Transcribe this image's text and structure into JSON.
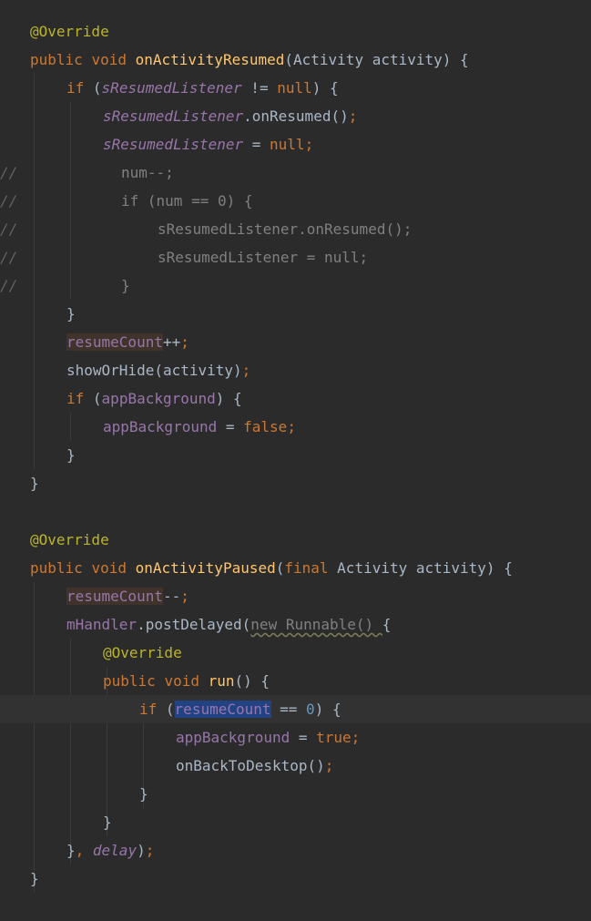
{
  "editor": {
    "lines": [
      {
        "indent": 33,
        "comment": "",
        "tokens": [
          {
            "t": "@Override",
            "c": "ann"
          }
        ]
      },
      {
        "indent": 33,
        "comment": "",
        "tokens": [
          {
            "t": "public ",
            "c": "kw"
          },
          {
            "t": "void ",
            "c": "kw"
          },
          {
            "t": "onActivityResumed",
            "c": "fn"
          },
          {
            "t": "(Activity activity) {",
            "c": "plain"
          }
        ]
      },
      {
        "indent": 73,
        "comment": "",
        "tokens": [
          {
            "t": "if ",
            "c": "kw"
          },
          {
            "t": "(",
            "c": "plain"
          },
          {
            "t": "sResumedListener",
            "c": "static"
          },
          {
            "t": " != ",
            "c": "plain"
          },
          {
            "t": "null",
            "c": "kw"
          },
          {
            "t": ") {",
            "c": "plain"
          }
        ]
      },
      {
        "indent": 113,
        "comment": "",
        "tokens": [
          {
            "t": "sResumedListener",
            "c": "static"
          },
          {
            "t": ".onResumed()",
            "c": "plain"
          },
          {
            "t": ";",
            "c": "punc"
          }
        ]
      },
      {
        "indent": 113,
        "comment": "",
        "tokens": [
          {
            "t": "sResumedListener",
            "c": "static"
          },
          {
            "t": " = ",
            "c": "plain"
          },
          {
            "t": "null",
            "c": "kw"
          },
          {
            "t": ";",
            "c": "punc"
          }
        ]
      },
      {
        "indent": 133,
        "comment": "//",
        "tokens": [
          {
            "t": "num--;",
            "c": "dim"
          }
        ]
      },
      {
        "indent": 133,
        "comment": "//",
        "tokens": [
          {
            "t": "if (num == 0) {",
            "c": "dim"
          }
        ]
      },
      {
        "indent": 173,
        "comment": "//",
        "tokens": [
          {
            "t": "sResumedListener.onResumed();",
            "c": "dim"
          }
        ]
      },
      {
        "indent": 173,
        "comment": "//",
        "tokens": [
          {
            "t": "sResumedListener = null;",
            "c": "dim"
          }
        ]
      },
      {
        "indent": 133,
        "comment": "//",
        "tokens": [
          {
            "t": "}",
            "c": "dim"
          }
        ]
      },
      {
        "indent": 73,
        "comment": "",
        "tokens": [
          {
            "t": "}",
            "c": "plain"
          }
        ]
      },
      {
        "indent": 73,
        "comment": "",
        "tokens": [
          {
            "t": "resumeCount",
            "c": "field",
            "hl": "write"
          },
          {
            "t": "++",
            "c": "plain"
          },
          {
            "t": ";",
            "c": "punc"
          }
        ]
      },
      {
        "indent": 73,
        "comment": "",
        "tokens": [
          {
            "t": "showOrHide(activity)",
            "c": "plain"
          },
          {
            "t": ";",
            "c": "punc"
          }
        ]
      },
      {
        "indent": 73,
        "comment": "",
        "tokens": [
          {
            "t": "if ",
            "c": "kw"
          },
          {
            "t": "(",
            "c": "plain"
          },
          {
            "t": "appBackground",
            "c": "field"
          },
          {
            "t": ") {",
            "c": "plain"
          }
        ]
      },
      {
        "indent": 113,
        "comment": "",
        "tokens": [
          {
            "t": "appBackground",
            "c": "field"
          },
          {
            "t": " = ",
            "c": "plain"
          },
          {
            "t": "false",
            "c": "kw"
          },
          {
            "t": ";",
            "c": "punc"
          }
        ]
      },
      {
        "indent": 73,
        "comment": "",
        "tokens": [
          {
            "t": "}",
            "c": "plain"
          }
        ]
      },
      {
        "indent": 33,
        "comment": "",
        "tokens": [
          {
            "t": "}",
            "c": "plain"
          }
        ]
      },
      {
        "indent": 33,
        "comment": "",
        "tokens": []
      },
      {
        "indent": 33,
        "comment": "",
        "tokens": [
          {
            "t": "@Override",
            "c": "ann"
          }
        ]
      },
      {
        "indent": 33,
        "comment": "",
        "tokens": [
          {
            "t": "public ",
            "c": "kw"
          },
          {
            "t": "void ",
            "c": "kw"
          },
          {
            "t": "onActivityPaused",
            "c": "fn"
          },
          {
            "t": "(",
            "c": "plain"
          },
          {
            "t": "final ",
            "c": "kw"
          },
          {
            "t": "Activity activity) {",
            "c": "plain"
          }
        ]
      },
      {
        "indent": 73,
        "comment": "",
        "tokens": [
          {
            "t": "resumeCount",
            "c": "field",
            "hl": "write"
          },
          {
            "t": "--",
            "c": "plain"
          },
          {
            "t": ";",
            "c": "punc"
          }
        ]
      },
      {
        "indent": 73,
        "comment": "",
        "tokens": [
          {
            "t": "mHandler",
            "c": "field"
          },
          {
            "t": ".postDelayed(",
            "c": "plain"
          },
          {
            "t": "new Runnable() ",
            "c": "warn"
          },
          {
            "t": "{",
            "c": "plain"
          }
        ]
      },
      {
        "indent": 113,
        "comment": "",
        "tokens": [
          {
            "t": "@Override",
            "c": "ann"
          }
        ]
      },
      {
        "indent": 113,
        "comment": "",
        "tokens": [
          {
            "t": "public ",
            "c": "kw"
          },
          {
            "t": "void ",
            "c": "kw"
          },
          {
            "t": "run",
            "c": "fn"
          },
          {
            "t": "() {",
            "c": "plain"
          }
        ]
      },
      {
        "indent": 153,
        "comment": "",
        "current": true,
        "tokens": [
          {
            "t": "if ",
            "c": "kw"
          },
          {
            "t": "(",
            "c": "plain"
          },
          {
            "t": "resumeCount",
            "c": "field",
            "hl": "sel"
          },
          {
            "t": " == ",
            "c": "plain"
          },
          {
            "t": "0",
            "c": "num"
          },
          {
            "t": ") {",
            "c": "plain"
          }
        ]
      },
      {
        "indent": 193,
        "comment": "",
        "tokens": [
          {
            "t": "appBackground",
            "c": "field"
          },
          {
            "t": " = ",
            "c": "plain"
          },
          {
            "t": "true",
            "c": "kw"
          },
          {
            "t": ";",
            "c": "punc"
          }
        ]
      },
      {
        "indent": 193,
        "comment": "",
        "tokens": [
          {
            "t": "onBackToDesktop()",
            "c": "plain"
          },
          {
            "t": ";",
            "c": "punc"
          }
        ]
      },
      {
        "indent": 153,
        "comment": "",
        "tokens": [
          {
            "t": "}",
            "c": "plain"
          }
        ]
      },
      {
        "indent": 113,
        "comment": "",
        "tokens": [
          {
            "t": "}",
            "c": "plain"
          }
        ]
      },
      {
        "indent": 73,
        "comment": "",
        "tokens": [
          {
            "t": "}",
            "c": "plain"
          },
          {
            "t": ", ",
            "c": "punc"
          },
          {
            "t": "delay",
            "c": "static"
          },
          {
            "t": ")",
            "c": "plain"
          },
          {
            "t": ";",
            "c": "punc"
          }
        ]
      },
      {
        "indent": 33,
        "comment": "",
        "tokens": [
          {
            "t": "}",
            "c": "plain"
          }
        ]
      }
    ]
  }
}
